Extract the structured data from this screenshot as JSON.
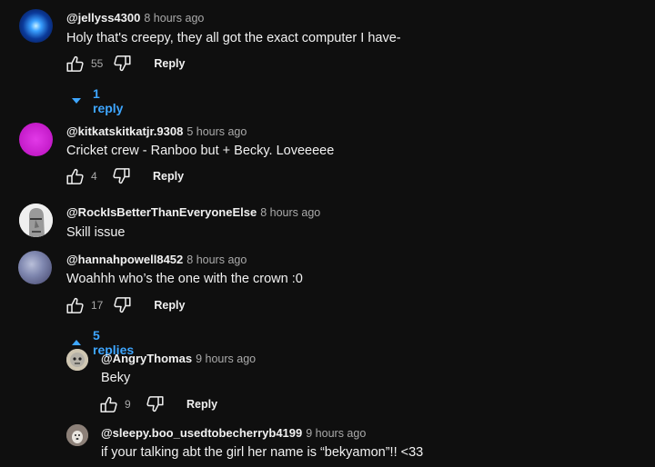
{
  "comments": [
    {
      "author": "@jellyss4300",
      "time": "8 hours ago",
      "text": "Holy that's creepy, they all got the exact computer I have-",
      "likes": "55",
      "reply_label": "Reply",
      "replies_toggle": "1 reply"
    },
    {
      "author": "@kitkatskitkatjr.9308",
      "time": "5 hours ago",
      "text": "Cricket crew - Ranboo but + Becky. Loveeeee",
      "likes": "4",
      "reply_label": "Reply"
    },
    {
      "author": "@RockIsBetterThanEveryoneElse",
      "time": "8 hours ago",
      "text": "Skill issue"
    },
    {
      "author": "@hannahpowell8452",
      "time": "8 hours ago",
      "text": "Woahhh who’s the one with the crown :0",
      "likes": "17",
      "reply_label": "Reply",
      "replies_toggle": "5 replies"
    }
  ],
  "replies": [
    {
      "author": "@AngryThomas",
      "time": "9 hours ago",
      "text": "Beky",
      "likes": "9",
      "reply_label": "Reply"
    },
    {
      "author": "@sleepy.boo_usedtobecherryb4199",
      "time": "9 hours ago",
      "text": "if your talking abt the girl her name is “bekyamon”!! <33"
    }
  ],
  "icons": {
    "like": "thumbs-up-icon",
    "dislike": "thumbs-down-icon",
    "expand": "caret-down-icon",
    "collapse": "caret-up-icon"
  },
  "colors": {
    "background": "#0f0f0f",
    "link": "#3ea6ff",
    "secondary_text": "#aaaaaa"
  }
}
